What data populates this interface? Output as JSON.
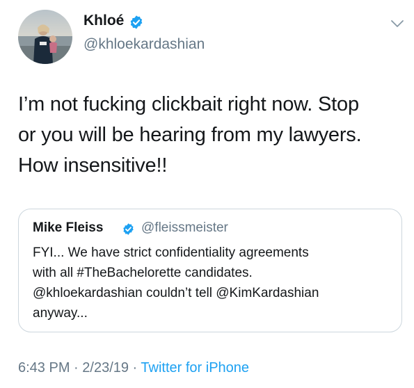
{
  "author": {
    "name": "Khloé",
    "handle": "@khloekardashian",
    "verified": true
  },
  "tweet": {
    "lines": [
      "I’m not fucking clickbait right now. Stop",
      "or you will be hearing from my lawyers.",
      "How insensitive!!"
    ]
  },
  "quote": {
    "name": "Mike Fleiss",
    "handle": "@fleissmeister",
    "verified": true,
    "lines": [
      "FYI... We have strict confidentiality agreements",
      "with all #TheBachelorette candidates.",
      "@khloekardashian couldn’t tell @KimKardashian",
      "anyway..."
    ]
  },
  "meta": {
    "time": "6:43 PM",
    "sep1": " · ",
    "date": "2/23/19",
    "sep2": " · ",
    "source": "Twitter for iPhone"
  },
  "colors": {
    "text": "#14171a",
    "secondary": "#657786",
    "accent": "#1da1f2",
    "border": "#ccd6dd"
  },
  "icons": {
    "verified": "verified-badge-icon",
    "more": "chevron-down-icon"
  }
}
